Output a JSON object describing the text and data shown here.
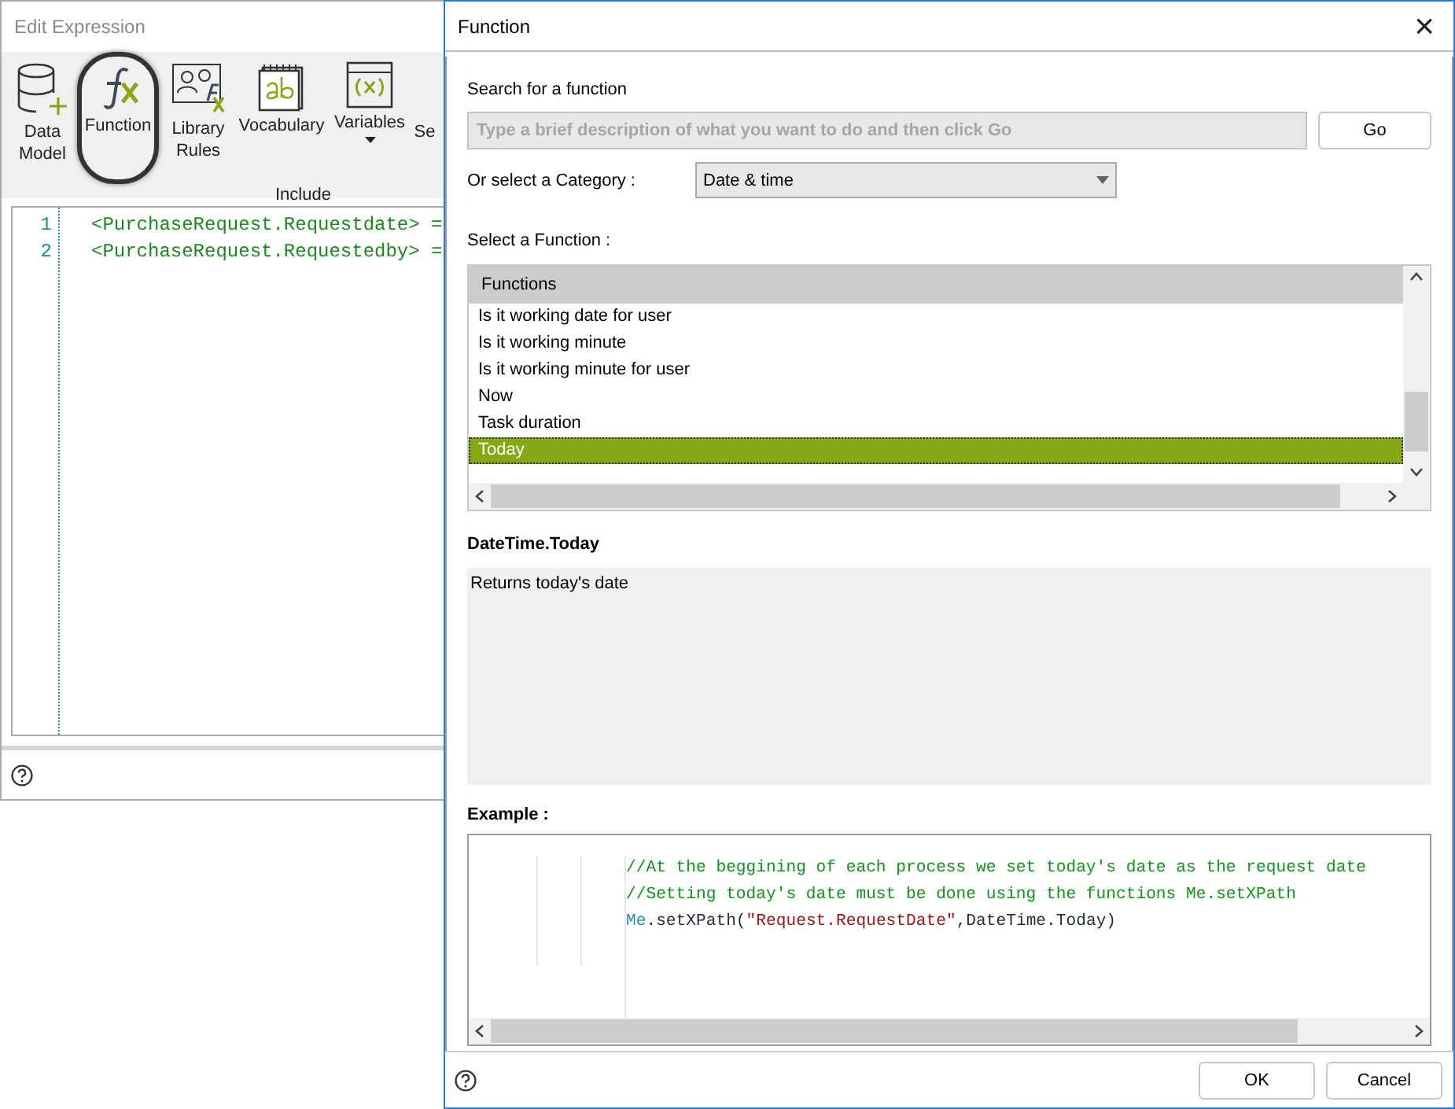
{
  "editor_window": {
    "title": "Edit Expression",
    "ribbon": {
      "buttons": [
        {
          "label": "Data Model",
          "kind": "database",
          "highlighted": false,
          "has_menu": false
        },
        {
          "label": "Function",
          "kind": "function",
          "highlighted": true,
          "has_menu": false
        },
        {
          "label": "Library Rules",
          "kind": "library",
          "highlighted": false,
          "has_menu": false
        },
        {
          "label": "Vocabulary",
          "kind": "vocabulary",
          "highlighted": false,
          "has_menu": false
        },
        {
          "label": "Variables",
          "kind": "variables",
          "highlighted": false,
          "has_menu": true
        },
        {
          "label": "Se",
          "kind": "cut"
        }
      ],
      "group_label": "Include"
    },
    "code_lines": [
      {
        "number": "1",
        "text": "<PurchaseRequest.Requestdate> ="
      },
      {
        "number": "2",
        "text": "<PurchaseRequest.Requestedby> ="
      }
    ]
  },
  "function_dialog": {
    "title": "Function",
    "close": "×",
    "search": {
      "label": "Search for a function",
      "placeholder": "Type a brief description of what you want to do and then click Go",
      "button": "Go"
    },
    "category": {
      "label": "Or select a Category :",
      "value": "Date & time"
    },
    "function_list": {
      "label": "Select a Function :",
      "header": "Functions",
      "items": [
        {
          "label": "Is it working date for user",
          "selected": false
        },
        {
          "label": "Is it working minute",
          "selected": false
        },
        {
          "label": "Is it working minute for user",
          "selected": false
        },
        {
          "label": "Now",
          "selected": false
        },
        {
          "label": "Task duration",
          "selected": false
        },
        {
          "label": "Today",
          "selected": true
        }
      ]
    },
    "function_name": "DateTime.Today",
    "description": "Returns today's date",
    "example": {
      "label": "Example :",
      "lines": [
        [
          {
            "kind": "comment",
            "text": "//At the beggining of each process we set today's date as the request date"
          }
        ],
        [
          {
            "kind": "comment",
            "text": "//Setting today's date must be done using the functions Me.setXPath"
          }
        ],
        [
          {
            "kind": "keyword",
            "text": "Me"
          },
          {
            "kind": "plain",
            "text": ".setXPath("
          },
          {
            "kind": "string",
            "text": "\"Request.RequestDate\""
          },
          {
            "kind": "plain",
            "text": ",DateTime.Today)"
          }
        ]
      ]
    },
    "buttons": [
      "OK",
      "Cancel"
    ]
  }
}
